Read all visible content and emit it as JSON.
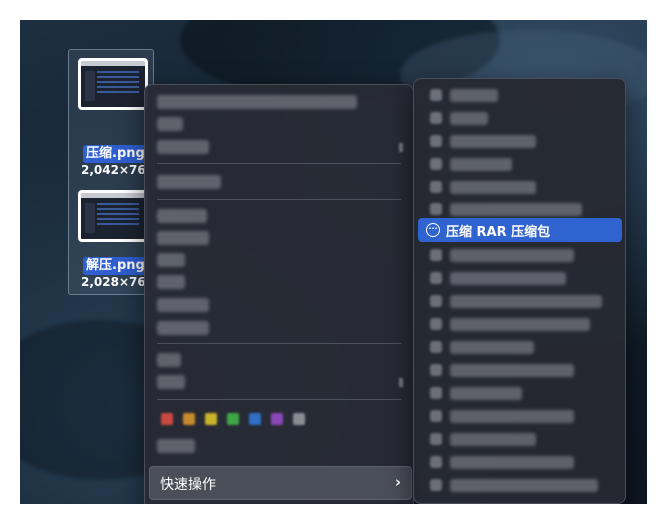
{
  "desktop": {
    "files": [
      {
        "name": "压缩.png",
        "size": "2,042×76"
      },
      {
        "name": "解压.png",
        "size": "2,028×76"
      }
    ]
  },
  "context_menu": {
    "quick_actions_label": "快速操作",
    "quick_actions_chevron": "›",
    "tag_colors": [
      "#c94a42",
      "#c78a2c",
      "#c9b22c",
      "#3fa548",
      "#2f6fc4",
      "#8a48b8",
      "#8a8d94"
    ]
  },
  "quick_actions_submenu": {
    "highlighted_item": {
      "icon": "more-circle-icon",
      "icon_glyph": "···",
      "label": "压缩 RAR 压缩包"
    }
  }
}
